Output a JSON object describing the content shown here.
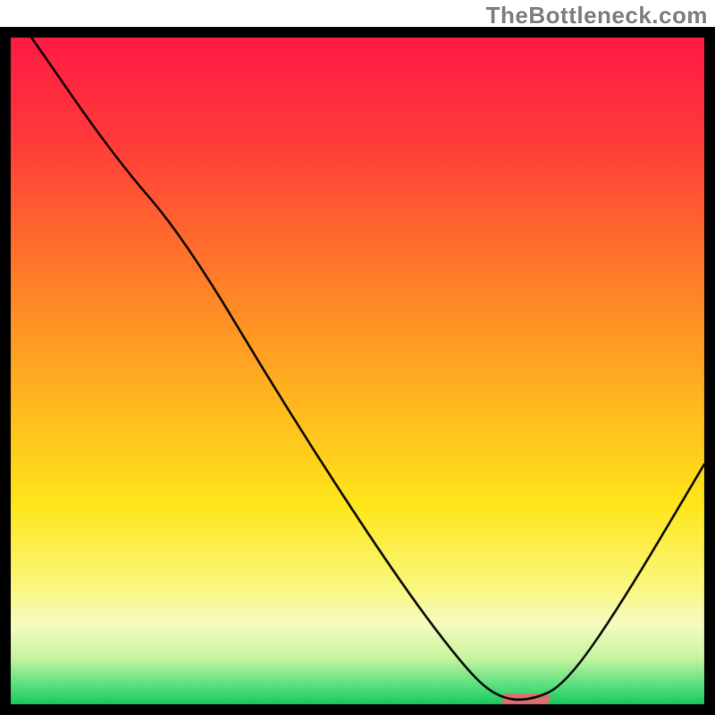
{
  "watermark": "TheBottleneck.com",
  "chart_data": {
    "type": "line",
    "xlim": [
      0,
      100
    ],
    "ylim": [
      0,
      100
    ],
    "gradient_stops": [
      {
        "pos": 0.0,
        "color": "#ff1a44"
      },
      {
        "pos": 0.15,
        "color": "#ff3a3a"
      },
      {
        "pos": 0.35,
        "color": "#ff7a2a"
      },
      {
        "pos": 0.55,
        "color": "#ffb81f"
      },
      {
        "pos": 0.7,
        "color": "#ffe61a"
      },
      {
        "pos": 0.82,
        "color": "#faf77a"
      },
      {
        "pos": 0.88,
        "color": "#f5fbc0"
      },
      {
        "pos": 0.93,
        "color": "#c9f5a0"
      },
      {
        "pos": 0.97,
        "color": "#5fe080"
      },
      {
        "pos": 1.0,
        "color": "#18c95c"
      }
    ],
    "curve_points": [
      {
        "x": 3.0,
        "y": 100.0
      },
      {
        "x": 15.0,
        "y": 82.0
      },
      {
        "x": 25.0,
        "y": 70.0
      },
      {
        "x": 40.0,
        "y": 44.0
      },
      {
        "x": 55.0,
        "y": 20.0
      },
      {
        "x": 65.0,
        "y": 6.0
      },
      {
        "x": 70.0,
        "y": 1.0
      },
      {
        "x": 75.0,
        "y": 0.5
      },
      {
        "x": 80.0,
        "y": 3.0
      },
      {
        "x": 88.0,
        "y": 15.0
      },
      {
        "x": 100.0,
        "y": 36.0
      }
    ],
    "marker": {
      "x_start": 71.5,
      "x_end": 77.0,
      "y": 0.8,
      "color": "#d9716e",
      "thickness": 12
    },
    "border": {
      "width": 12,
      "color": "#000000"
    },
    "line_style": {
      "width": 2.5,
      "color": "#000000"
    }
  }
}
